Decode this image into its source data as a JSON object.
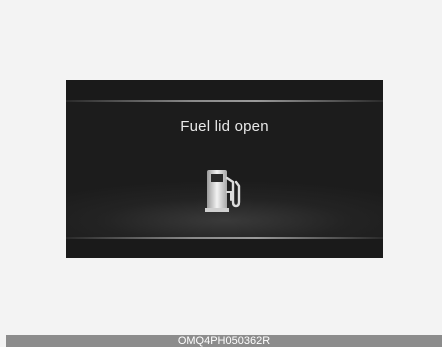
{
  "display": {
    "message": "Fuel lid open",
    "icon": "fuel-pump-icon"
  },
  "figure": {
    "code": "OMQ4PH050362R"
  },
  "colors": {
    "page_background": "#f3f3f3",
    "display_background": "#1b1b1b",
    "text": "#e8e8e8",
    "code_bar": "#8c8c8c"
  }
}
